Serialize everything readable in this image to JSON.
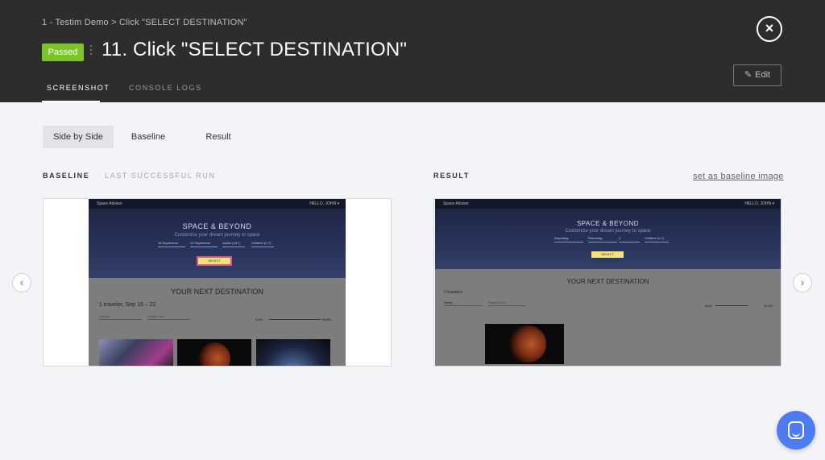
{
  "header": {
    "breadcrumb": "1 - Testim Demo > Click \"SELECT DESTINATION\"",
    "status_badge": "Passed",
    "title": "11. Click \"SELECT DESTINATION\"",
    "close_icon": "×",
    "edit_label": "Edit",
    "edit_icon": "✎",
    "tabs": [
      {
        "label": "SCREENSHOT",
        "active": true
      },
      {
        "label": "CONSOLE LOGS",
        "active": false
      }
    ]
  },
  "view_modes": [
    {
      "label": "Side by Side",
      "active": true
    },
    {
      "label": "Baseline",
      "active": false
    },
    {
      "label": "Result",
      "active": false
    }
  ],
  "baseline": {
    "label": "BASELINE",
    "sub_label": "LAST SUCCESSFUL RUN",
    "screenshot": {
      "brand": "Space Advisor",
      "user": "HELLO, JOHN ▾",
      "heading": "SPACE & BEYOND",
      "subheading": "Customize your dream journey to space",
      "fields": [
        "16 September",
        "22 September",
        "Adults (18+)",
        "Children (0-7)"
      ],
      "button": "SELECT DESTINATION",
      "destination_title": "YOUR NEXT DESTINATION",
      "summary": "1 traveler, Sep 16 – 22",
      "filters": [
        "Launch",
        "Planet color"
      ],
      "price_min": "$100",
      "price_max": "$1600"
    }
  },
  "result": {
    "label": "RESULT",
    "set_baseline_link": "set as baseline image",
    "screenshot": {
      "brand": "Space Advisor",
      "user": "HELLO, JOHN ▾",
      "heading": "SPACE & BEYOND",
      "subheading": "Customize your dream journey to space",
      "fields": [
        "Departing",
        "Returning",
        "2",
        "Children (0-7)"
      ],
      "button": "SELECT DESTINATION",
      "destination_title": "YOUR NEXT DESTINATION",
      "summary": "2 travelers",
      "filters": [
        "Newly",
        "Planet color"
      ],
      "price_min": "$100",
      "price_max": "$1200"
    }
  },
  "navigation": {
    "prev_icon": "‹",
    "next_icon": "›"
  },
  "colors": {
    "passed": "#7dc42a",
    "header_bg": "#2d2d2d",
    "chat_button": "#4c7bf2",
    "highlight": "#e05588"
  }
}
